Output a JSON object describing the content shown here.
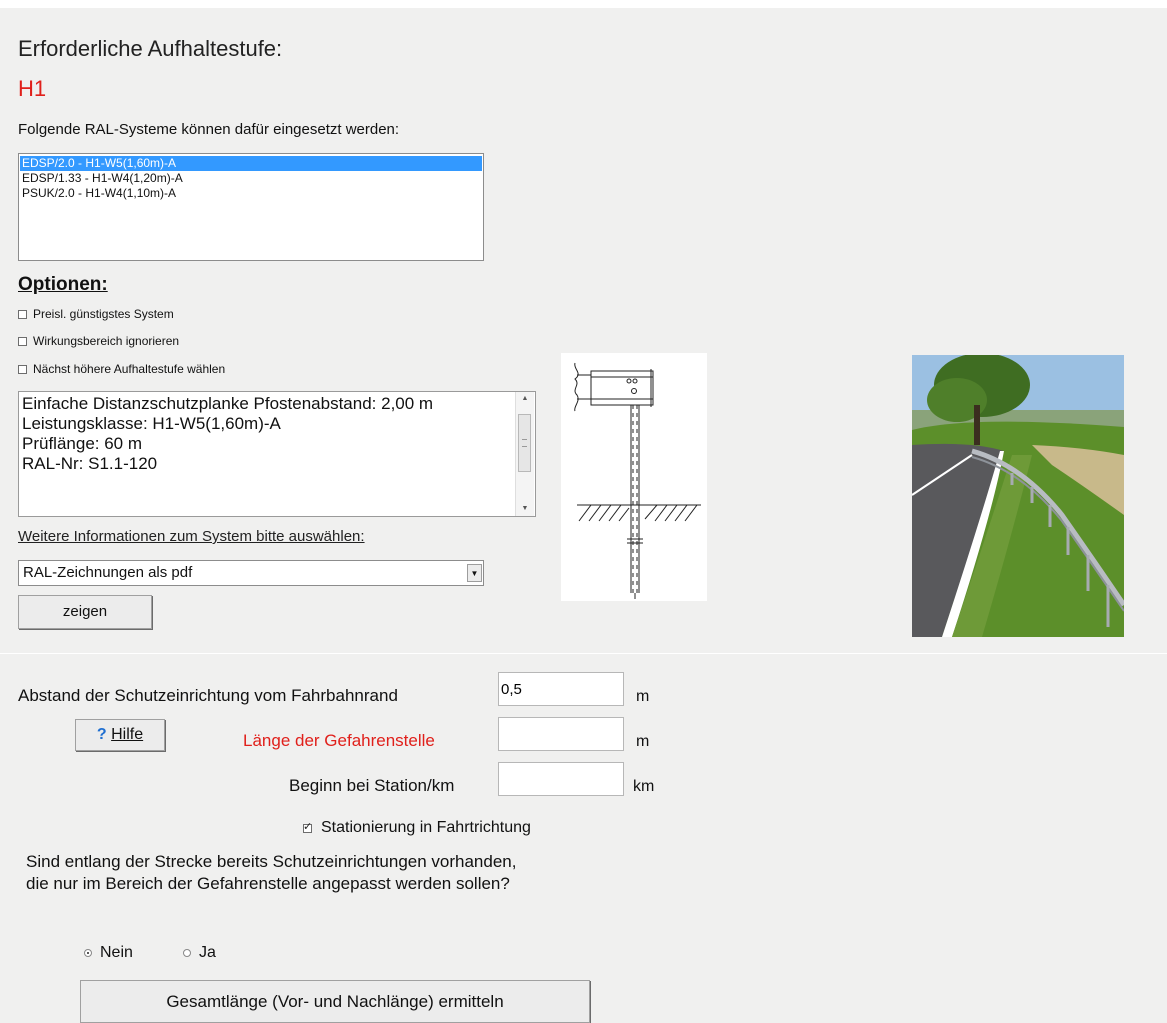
{
  "header": {
    "title": "Erforderliche Aufhaltestufe:",
    "level": "H1",
    "intro": "Folgende RAL-Systeme können dafür eingesetzt werden:"
  },
  "systems": {
    "items": [
      {
        "label": "EDSP/2.0 - H1-W5(1,60m)-A",
        "selected": true
      },
      {
        "label": "EDSP/1.33 - H1-W4(1,20m)-A",
        "selected": false
      },
      {
        "label": "PSUK/2.0 - H1-W4(1,10m)-A",
        "selected": false
      }
    ]
  },
  "options": {
    "title": "Optionen:",
    "items": [
      {
        "label": "Preisl. günstigstes System",
        "checked": false
      },
      {
        "label": "Wirkungsbereich ignorieren",
        "checked": false
      },
      {
        "label": "Nächst höhere Aufhaltestufe wählen",
        "checked": false
      }
    ]
  },
  "info": {
    "lines": [
      "Einfache Distanzschutzplanke Pfostenabstand: 2,00 m",
      "Leistungsklasse: H1-W5(1,60m)-A",
      "Prüflänge: 60 m",
      "RAL-Nr: S1.1-120"
    ]
  },
  "more_info": {
    "link": "Weitere Informationen zum System bitte auswählen:",
    "select_value": "RAL-Zeichnungen als pdf",
    "show_button": "zeigen"
  },
  "form": {
    "distance_label": "Abstand der Schutzeinrichtung vom Fahrbahnrand",
    "distance_value": "0,5",
    "distance_unit": "m",
    "help_label": "Hilfe",
    "help_icon": "question-icon",
    "length_label": "Länge der Gefahrenstelle",
    "length_value": "",
    "length_unit": "m",
    "start_label": "Beginn bei Station/km",
    "start_value": "",
    "start_unit": "km",
    "direction_label": "Stationierung in Fahrtrichtung",
    "direction_checked": true,
    "question_line1": "Sind entlang der Strecke bereits Schutzeinrichtungen vorhanden,",
    "question_line2": "die nur im Bereich der Gefahrenstelle angepasst werden sollen?",
    "no_label": "Nein",
    "yes_label": "Ja",
    "selected": "Nein",
    "calc_button": "Gesamtlänge (Vor- und Nachlänge) ermitteln"
  },
  "colors": {
    "accent_red": "#e0201b",
    "selection_blue": "#3399ff",
    "panel_bg": "#f0f0ef"
  }
}
